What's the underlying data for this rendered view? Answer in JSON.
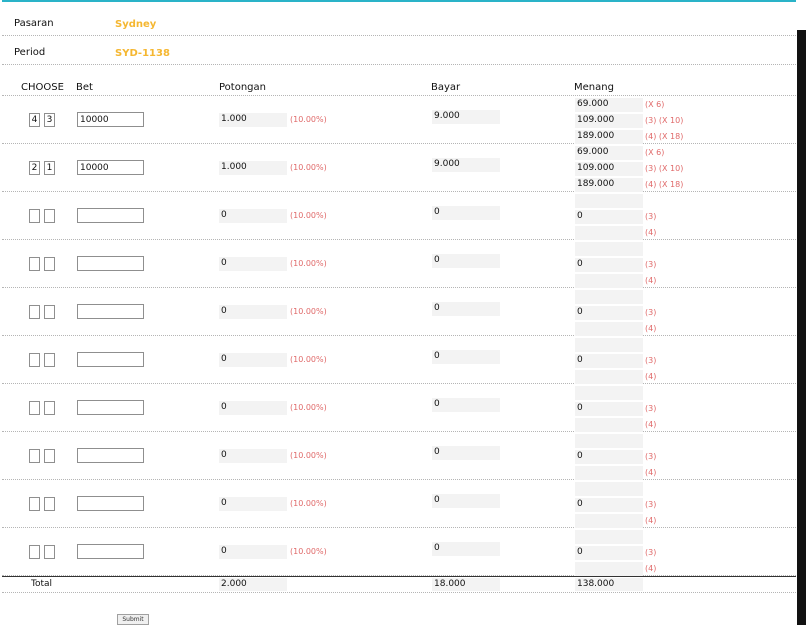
{
  "market": {
    "label": "Pasaran",
    "value": "Sydney"
  },
  "period": {
    "label": "Period",
    "value": "SYD-1138"
  },
  "headers": {
    "choose": "CHOOSE",
    "bet": "Bet",
    "potongan": "Potongan",
    "bayar": "Bayar",
    "menang": "Menang"
  },
  "rows": [
    {
      "d1": "4",
      "d2": "3",
      "bet": "10000",
      "potongan": "1.000",
      "pct": "(10.00%)",
      "bayar": "9.000",
      "menang": [
        {
          "amount": "69.000",
          "note": "(X 6)"
        },
        {
          "amount": "109.000",
          "note": "(3) (X 10)"
        },
        {
          "amount": "189.000",
          "note": "(4) (X 18)"
        }
      ]
    },
    {
      "d1": "2",
      "d2": "1",
      "bet": "10000",
      "potongan": "1.000",
      "pct": "(10.00%)",
      "bayar": "9.000",
      "menang": [
        {
          "amount": "69.000",
          "note": "(X 6)"
        },
        {
          "amount": "109.000",
          "note": "(3) (X 10)"
        },
        {
          "amount": "189.000",
          "note": "(4) (X 18)"
        }
      ]
    },
    {
      "d1": "",
      "d2": "",
      "bet": "",
      "potongan": "0",
      "pct": "(10.00%)",
      "bayar": "0",
      "menang": [
        {
          "amount": "",
          "note": ""
        },
        {
          "amount": "0",
          "note": "(3)"
        },
        {
          "amount": "",
          "note": "(4)"
        }
      ]
    },
    {
      "d1": "",
      "d2": "",
      "bet": "",
      "potongan": "0",
      "pct": "(10.00%)",
      "bayar": "0",
      "menang": [
        {
          "amount": "",
          "note": ""
        },
        {
          "amount": "0",
          "note": "(3)"
        },
        {
          "amount": "",
          "note": "(4)"
        }
      ]
    },
    {
      "d1": "",
      "d2": "",
      "bet": "",
      "potongan": "0",
      "pct": "(10.00%)",
      "bayar": "0",
      "menang": [
        {
          "amount": "",
          "note": ""
        },
        {
          "amount": "0",
          "note": "(3)"
        },
        {
          "amount": "",
          "note": "(4)"
        }
      ]
    },
    {
      "d1": "",
      "d2": "",
      "bet": "",
      "potongan": "0",
      "pct": "(10.00%)",
      "bayar": "0",
      "menang": [
        {
          "amount": "",
          "note": ""
        },
        {
          "amount": "0",
          "note": "(3)"
        },
        {
          "amount": "",
          "note": "(4)"
        }
      ]
    },
    {
      "d1": "",
      "d2": "",
      "bet": "",
      "potongan": "0",
      "pct": "(10.00%)",
      "bayar": "0",
      "menang": [
        {
          "amount": "",
          "note": ""
        },
        {
          "amount": "0",
          "note": "(3)"
        },
        {
          "amount": "",
          "note": "(4)"
        }
      ]
    },
    {
      "d1": "",
      "d2": "",
      "bet": "",
      "potongan": "0",
      "pct": "(10.00%)",
      "bayar": "0",
      "menang": [
        {
          "amount": "",
          "note": ""
        },
        {
          "amount": "0",
          "note": "(3)"
        },
        {
          "amount": "",
          "note": "(4)"
        }
      ]
    },
    {
      "d1": "",
      "d2": "",
      "bet": "",
      "potongan": "0",
      "pct": "(10.00%)",
      "bayar": "0",
      "menang": [
        {
          "amount": "",
          "note": ""
        },
        {
          "amount": "0",
          "note": "(3)"
        },
        {
          "amount": "",
          "note": "(4)"
        }
      ]
    },
    {
      "d1": "",
      "d2": "",
      "bet": "",
      "potongan": "0",
      "pct": "(10.00%)",
      "bayar": "0",
      "menang": [
        {
          "amount": "",
          "note": ""
        },
        {
          "amount": "0",
          "note": "(3)"
        },
        {
          "amount": "",
          "note": "(4)"
        }
      ]
    }
  ],
  "total": {
    "label": "Total",
    "potongan": "2.000",
    "bayar": "18.000",
    "menang": "138.000"
  },
  "submit_label": "Submit",
  "colors": {
    "accent_line": "#2ab3c8",
    "market_value": "#f5b731",
    "percent_note": "#e06a6a"
  }
}
